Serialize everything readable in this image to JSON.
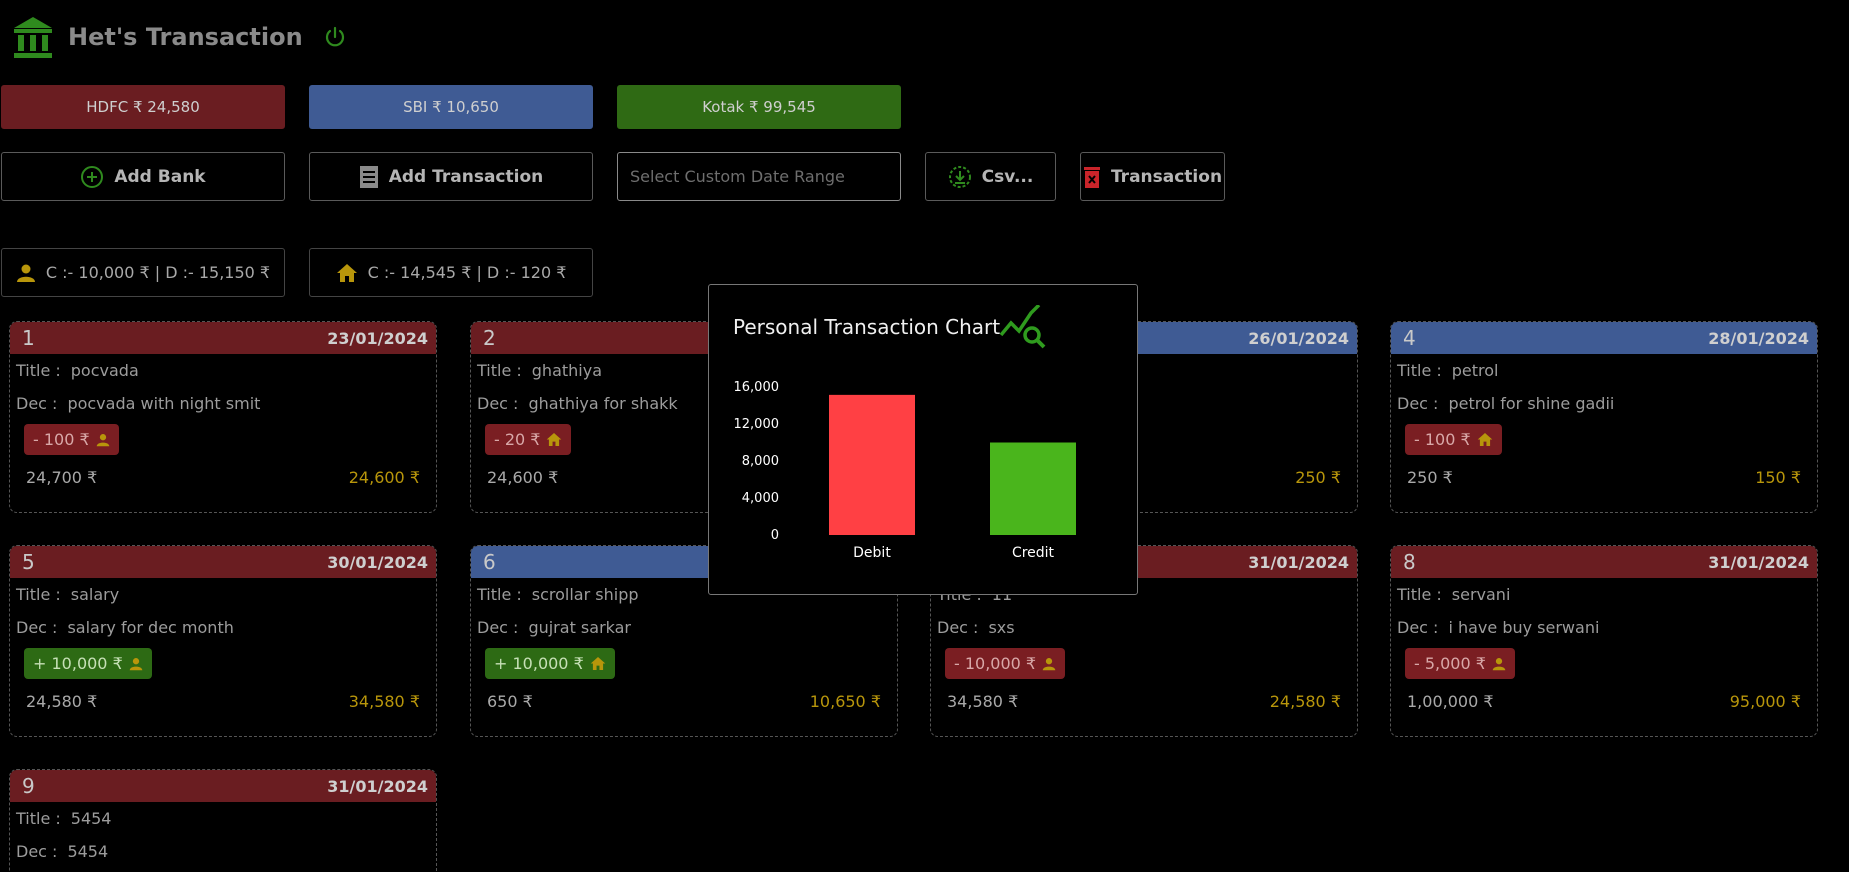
{
  "header": {
    "title": "Het's Transaction",
    "logo_icon": "bank-icon",
    "power_icon": "power-icon"
  },
  "banks": [
    {
      "label": "HDFC ₹ 24,580",
      "color": "#6a1d21"
    },
    {
      "label": "SBI ₹ 10,650",
      "color": "#3f5b94"
    },
    {
      "label": "Kotak ₹ 99,545",
      "color": "#2f6a14"
    }
  ],
  "actions": {
    "add_bank": "Add Bank",
    "add_transaction": "Add Transaction",
    "date_placeholder": "Select Custom Date Range",
    "csv": "Csv...",
    "transaction": "Transaction"
  },
  "summary": {
    "personal": "C :- 10,000 ₹ | D :- 15,150 ₹",
    "home": "C :- 14,545 ₹ | D :- 120 ₹"
  },
  "labels": {
    "title": "Title :",
    "dec": "Dec :"
  },
  "cards": [
    {
      "num": "1",
      "date": "23/01/2024",
      "title": "pocvada",
      "dec": "pocvada with night smit",
      "amount": "- 100 ₹",
      "type": "debit",
      "category": "personal",
      "before": "24,700 ₹",
      "after": "24,600 ₹",
      "bank": "red"
    },
    {
      "num": "2",
      "date": "",
      "title": "ghathiya",
      "dec": "ghathiya for shakk",
      "amount": "- 20 ₹",
      "type": "debit",
      "category": "home",
      "before": "24,600 ₹",
      "after": "",
      "bank": "red"
    },
    {
      "num": "",
      "date": "26/01/2024",
      "title": "",
      "dec": "",
      "amount": "",
      "type": "",
      "category": "",
      "before": "",
      "after": "250 ₹",
      "bank": "blue"
    },
    {
      "num": "4",
      "date": "28/01/2024",
      "title": "petrol",
      "dec": "petrol for shine gadii",
      "amount": "- 100 ₹",
      "type": "debit",
      "category": "home",
      "before": "250 ₹",
      "after": "150 ₹",
      "bank": "blue"
    },
    {
      "num": "5",
      "date": "30/01/2024",
      "title": "salary",
      "dec": "salary for dec month",
      "amount": "+ 10,000 ₹",
      "type": "credit",
      "category": "personal",
      "before": "24,580 ₹",
      "after": "34,580 ₹",
      "bank": "red"
    },
    {
      "num": "6",
      "date": "",
      "title": "scrollar shipp",
      "dec": "gujrat sarkar",
      "amount": "+ 10,000 ₹",
      "type": "credit",
      "category": "home",
      "before": "650 ₹",
      "after": "10,650 ₹",
      "bank": "blue"
    },
    {
      "num": "",
      "date": "31/01/2024",
      "title": "11",
      "dec": "sxs",
      "amount": "- 10,000 ₹",
      "type": "debit",
      "category": "personal",
      "before": "34,580 ₹",
      "after": "24,580 ₹",
      "bank": "red"
    },
    {
      "num": "8",
      "date": "31/01/2024",
      "title": "servani",
      "dec": "i have buy serwani",
      "amount": "- 5,000 ₹",
      "type": "debit",
      "category": "personal",
      "before": "1,00,000 ₹",
      "after": "95,000 ₹",
      "bank": "red"
    },
    {
      "num": "9",
      "date": "31/01/2024",
      "title": "5454",
      "dec": "5454",
      "amount": "",
      "type": "",
      "category": "",
      "before": "",
      "after": "",
      "bank": "red"
    }
  ],
  "modal": {
    "title": "Personal Transaction Chart",
    "icon": "chart-search-icon"
  },
  "chart_data": {
    "type": "bar",
    "categories": [
      "Debit",
      "Credit"
    ],
    "values": [
      15150,
      10000
    ],
    "colors": [
      "#ff4044",
      "#4ab51c"
    ],
    "yticks": [
      "0",
      "4,000",
      "8,000",
      "12,000",
      "16,000"
    ],
    "ylim": [
      0,
      16000
    ],
    "title": "Personal Transaction Chart",
    "xlabel": "",
    "ylabel": "",
    "grid": false
  },
  "colors": {
    "accent_green": "#2f8a1e",
    "gold": "#b8960b"
  }
}
